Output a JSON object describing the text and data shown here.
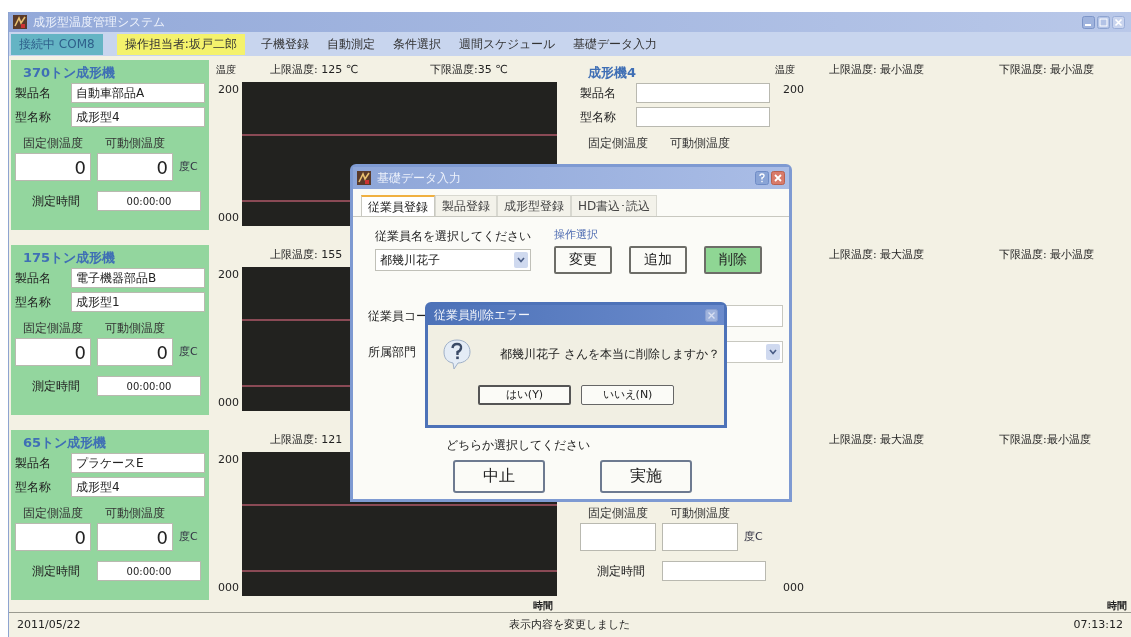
{
  "window": {
    "title": "成形型温度管理システム"
  },
  "menu_bar": [
    {
      "label": "接続中 COM8",
      "kind": "status"
    },
    {
      "label": "操作担当者:坂戸二郎",
      "kind": "operator"
    },
    {
      "label": "子機登録",
      "kind": "menu"
    },
    {
      "label": "自動測定",
      "kind": "menu"
    },
    {
      "label": "条件選択",
      "kind": "menu"
    },
    {
      "label": "週間スケジュール",
      "kind": "menu"
    },
    {
      "label": "基礎データ入力",
      "kind": "menu"
    }
  ],
  "rows": [
    {
      "left_panel": {
        "highlighted": true,
        "name": "370トン成形機",
        "product_label": "製品名",
        "product": "自動車部品A",
        "mold_label": "型名称",
        "mold": "成形型4",
        "fixed_label": "固定側温度",
        "moving_label": "可動側温度",
        "fixed_temp": "0",
        "moving_temp": "0",
        "unit": "度C",
        "time_label": "測定時間",
        "time": "00:00:00"
      },
      "left_chart": {
        "y_label": "温度",
        "upper": "上限温度: 125 ℃",
        "lower": "下限温度:35 ℃",
        "y_max": "200",
        "y_min": "000"
      },
      "right_panel": {
        "highlighted": false,
        "name": "成形機4",
        "product_label": "製品名",
        "mold_label": "型名称",
        "fixed_label": "固定側温度",
        "moving_label": "可動側温度"
      },
      "right_chart": {
        "y_label": "温度",
        "upper": "上限温度: 最小温度",
        "lower": "下限温度: 最小温度",
        "y_max": "200"
      }
    },
    {
      "left_panel": {
        "highlighted": true,
        "name": "175トン成形機",
        "product_label": "製品名",
        "product": "電子機器部品B",
        "mold_label": "型名称",
        "mold": "成形型1",
        "fixed_label": "固定側温度",
        "moving_label": "可動側温度",
        "fixed_temp": "0",
        "moving_temp": "0",
        "unit": "度C",
        "time_label": "測定時間",
        "time": "00:00:00"
      },
      "left_chart": {
        "upper": "上限温度: 155",
        "y_max": "200",
        "y_min": "000"
      },
      "right_chart": {
        "upper": "上限温度: 最大温度",
        "lower": "下限温度: 最小温度"
      }
    },
    {
      "left_panel": {
        "highlighted": true,
        "name": "65トン成形機",
        "product_label": "製品名",
        "product": "プラケースE",
        "mold_label": "型名称",
        "mold": "成形型4",
        "fixed_label": "固定側温度",
        "moving_label": "可動側温度",
        "fixed_temp": "0",
        "moving_temp": "0",
        "unit": "度C",
        "time_label": "測定時間",
        "time": "00:00:00"
      },
      "left_chart": {
        "upper": "上限温度: 121",
        "y_max": "200",
        "y_min": "000",
        "x_label": "時間"
      },
      "right_panel": {
        "highlighted": false,
        "fixed_label": "固定側温度",
        "moving_label": "可動側温度",
        "unit": "度C",
        "time_label": "測定時間"
      },
      "right_chart": {
        "upper": "上限温度: 最大温度",
        "lower": "下限温度:最小温度",
        "y_min": "000",
        "x_label": "時間"
      }
    }
  ],
  "dialog": {
    "title": "基礎データ入力",
    "tabs": [
      {
        "label": "従業員登録",
        "selected": true
      },
      {
        "label": "製品登録",
        "selected": false
      },
      {
        "label": "成形型登録",
        "selected": false
      },
      {
        "label": "HD書込･読込",
        "selected": false
      }
    ],
    "employee_prompt": "従業員名を選択してください",
    "employee": "都幾川花子",
    "operation_label": "操作選択",
    "operations": [
      {
        "label": "変更",
        "selected": false
      },
      {
        "label": "追加",
        "selected": false
      },
      {
        "label": "削除",
        "selected": true
      }
    ],
    "code_label": "従業員コー",
    "dept_label": "所属部門",
    "choose_prompt": "どちらか選択してください",
    "actions": [
      "中止",
      "実施"
    ]
  },
  "error_dialog": {
    "title": "従業員削除エラー",
    "message": "都幾川花子 さんを本当に削除しますか？",
    "buttons": [
      "はい(Y)",
      "いいえ(N)"
    ]
  },
  "status_bar": {
    "date": "2011/05/22",
    "message": "表示内容を変更しました",
    "time": "07:13:12"
  }
}
